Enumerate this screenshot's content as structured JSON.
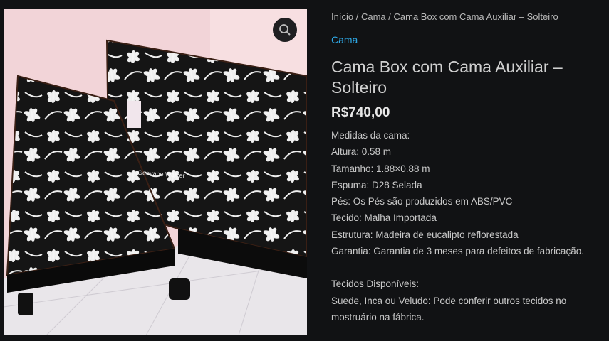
{
  "breadcrumb": {
    "home": "Início",
    "sep1": "/",
    "category": "Cama",
    "sep2": "/",
    "current": "Cama Box com Cama Auxiliar – Solteiro"
  },
  "product": {
    "category_link": "Cama",
    "title": "Cama Box com Cama Auxiliar – Solteiro",
    "price": "R$740,00",
    "image_watermark": "Geovane Walker",
    "zoom_icon": "magnifier-icon",
    "description": {
      "heading": "Medidas da cama:",
      "specs": [
        "Altura: 0.58 m",
        "Tamanho: 1.88×0.88 m",
        "Espuma: D28 Selada",
        "Pés: Os Pés são produzidos em ABS/PVC",
        "Tecido: Malha Importada",
        "Estrutura: Madeira de eucalipto reflorestada",
        "Garantia: Garantia de 3 meses para defeitos de fabricação."
      ],
      "fabrics_heading": "Tecidos Disponíveis:",
      "fabrics_line1": "Suede, Inca ou Veludo: Pode conferir outros tecidos no",
      "fabrics_line2": "mostruário na fábrica."
    }
  },
  "colors": {
    "background": "#111214",
    "link": "#2ea8e6",
    "text": "#c9c9c9"
  }
}
